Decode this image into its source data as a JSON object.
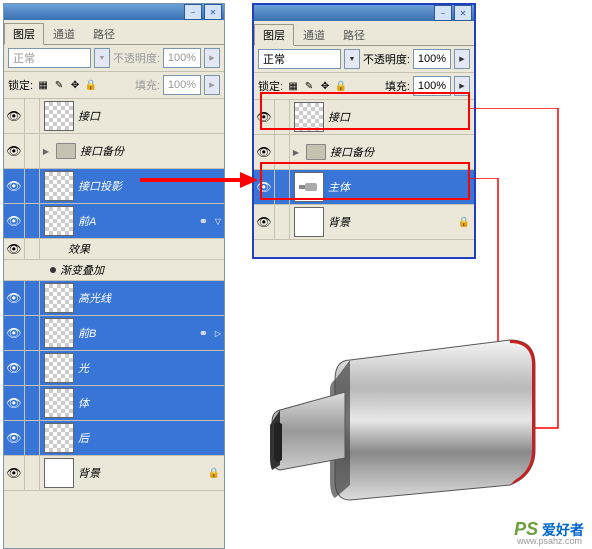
{
  "left_panel": {
    "tabs": [
      "图层",
      "通道",
      "路径"
    ],
    "blend_mode": "正常",
    "opacity_label": "不透明度:",
    "opacity_value": "100%",
    "lock_label": "锁定:",
    "fill_label": "填充:",
    "fill_value": "100%",
    "layers": [
      {
        "name": "接口",
        "thumb": "trans",
        "selected": false,
        "eye": true
      },
      {
        "name": "接口备份",
        "type": "folder",
        "eye": true
      },
      {
        "name": "接口投影",
        "thumb": "trans",
        "selected": true,
        "eye": true
      },
      {
        "name": "前A",
        "thumb": "trans",
        "selected": true,
        "eye": true,
        "link": true
      },
      {
        "name": "效果",
        "type": "sub",
        "eye": true
      },
      {
        "name": "渐变叠加",
        "type": "sub2"
      },
      {
        "name": "高光线",
        "thumb": "trans",
        "selected": true,
        "eye": true
      },
      {
        "name": "前B",
        "thumb": "trans",
        "selected": true,
        "eye": true,
        "link": true
      },
      {
        "name": "光",
        "thumb": "trans",
        "selected": true,
        "eye": true
      },
      {
        "name": "体",
        "thumb": "trans",
        "selected": true,
        "eye": true
      },
      {
        "name": "后",
        "thumb": "trans",
        "selected": true,
        "eye": true
      },
      {
        "name": "背景",
        "thumb": "white",
        "selected": false,
        "eye": true,
        "lock": true
      }
    ]
  },
  "right_panel": {
    "tabs": [
      "图层",
      "通道",
      "路径"
    ],
    "blend_mode": "正常",
    "opacity_label": "不透明度:",
    "opacity_value": "100%",
    "lock_label": "锁定:",
    "fill_label": "填充:",
    "fill_value": "100%",
    "layers": [
      {
        "name": "接口",
        "thumb": "trans",
        "selected": false,
        "eye": true
      },
      {
        "name": "接口备份",
        "type": "folder",
        "eye": true
      },
      {
        "name": "主体",
        "thumb": "usb",
        "selected": true,
        "eye": true
      },
      {
        "name": "背景",
        "thumb": "white",
        "selected": false,
        "eye": true,
        "lock": true
      }
    ]
  },
  "watermark": {
    "ps": "PS",
    "txt": "爱好者",
    "url": "www.psahz.com"
  }
}
